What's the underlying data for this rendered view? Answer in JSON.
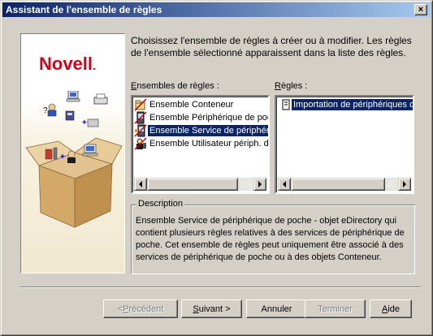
{
  "window": {
    "title": "Assistant de l'ensemble de règles",
    "close_glyph": "×"
  },
  "brand": {
    "logo_text": "Novell",
    "logo_mark": "."
  },
  "intro": {
    "text": "Choisissez l'ensemble de règles à créer ou à modifier. Les règles de l'ensemble sélectionné apparaissent dans la liste des règles."
  },
  "rulesets": {
    "label_prefix": "",
    "label_accel": "E",
    "label_rest": "nsembles de règles :",
    "items": [
      {
        "label": "Ensemble Conteneur",
        "icon": "container-icon",
        "selected": false
      },
      {
        "label": "Ensemble Périphérique de poche",
        "icon": "handheld-device-icon",
        "selected": false
      },
      {
        "label": "Ensemble Service de périphérique de poche",
        "icon": "handheld-service-icon",
        "selected": true
      },
      {
        "label": "Ensemble Utilisateur périph. de poche",
        "icon": "user-device-icon",
        "selected": false
      }
    ]
  },
  "rules": {
    "label_prefix": "",
    "label_accel": "R",
    "label_rest": "ègles :",
    "items": [
      {
        "label": "Importation de périphériques de poche",
        "icon": "import-rule-icon",
        "selected": true
      }
    ]
  },
  "description": {
    "legend": "Description",
    "text": "Ensemble Service de périphérique de poche - objet eDirectory qui contient plusieurs règles relatives à des services de périphérique de poche. Cet ensemble de règles peut uniquement être associé à des services de périphérique de poche ou à des objets Conteneur."
  },
  "buttons": {
    "prev": {
      "prefix": "< ",
      "accel": "P",
      "rest": "récédent",
      "enabled": false
    },
    "next": {
      "prefix": "",
      "accel": "S",
      "rest": "uivant >",
      "enabled": true
    },
    "cancel": {
      "label": "Annuler",
      "enabled": true
    },
    "finish": {
      "label": "Terminer",
      "enabled": false
    },
    "help": {
      "prefix": "",
      "accel": "A",
      "rest": "ide",
      "enabled": true
    }
  },
  "colors": {
    "titlebar_start": "#0a246a",
    "titlebar_end": "#a6caf0",
    "selection": "#0a246a",
    "brand_red": "#d0021b",
    "face": "#d4d0c8"
  }
}
